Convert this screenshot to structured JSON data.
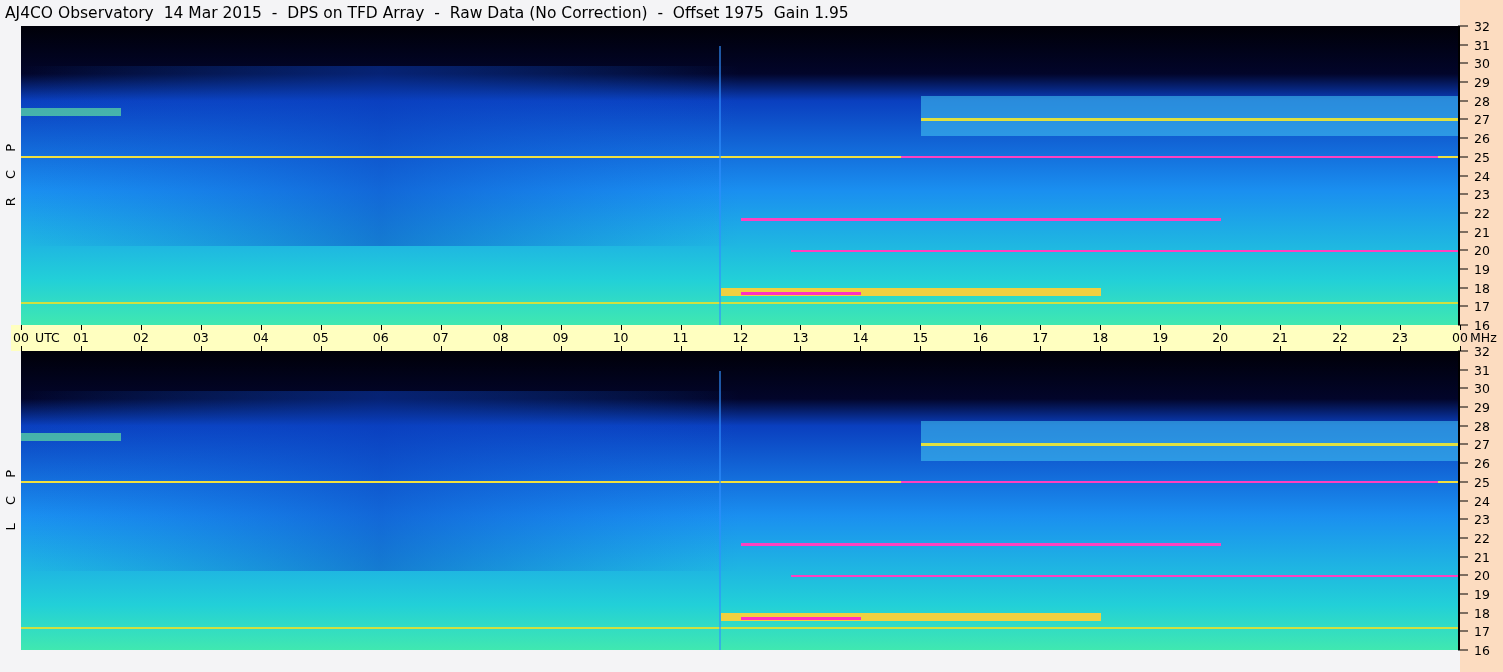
{
  "title": "AJ4CO Observatory  14 Mar 2015  -  DPS on TFD Array  -  Raw Data (No Correction)  -  Offset 1975  Gain 1.95",
  "panels": [
    {
      "label": "R C P",
      "frequency_labels": [
        "32",
        "31",
        "30",
        "29",
        "28",
        "27",
        "26",
        "25",
        "24",
        "23",
        "22",
        "21",
        "20",
        "19",
        "18",
        "17",
        "16"
      ]
    },
    {
      "label": "L C P",
      "frequency_labels": [
        "32",
        "31",
        "30",
        "29",
        "28",
        "27",
        "26",
        "25",
        "24",
        "23",
        "22",
        "21",
        "20",
        "19",
        "18",
        "17",
        "16"
      ]
    }
  ],
  "time_axis": {
    "labels": [
      "00",
      "01",
      "02",
      "03",
      "04",
      "05",
      "06",
      "07",
      "08",
      "09",
      "10",
      "11",
      "12",
      "13",
      "14",
      "15",
      "16",
      "17",
      "18",
      "19",
      "20",
      "21",
      "22",
      "23",
      "00"
    ],
    "start_unit": "UTC",
    "end_unit": "MHz"
  }
}
